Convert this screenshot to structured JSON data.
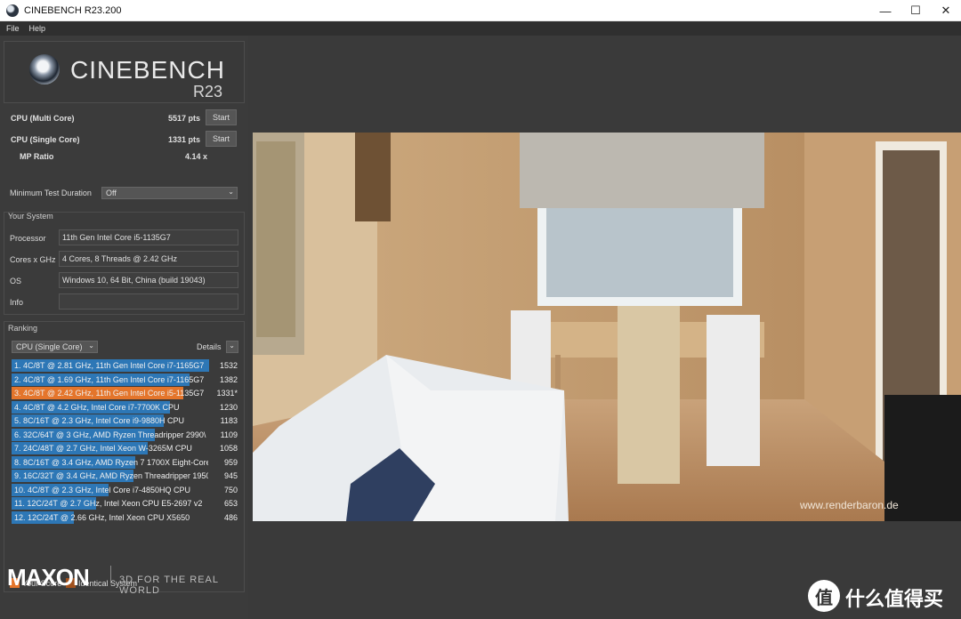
{
  "window": {
    "title": "CINEBENCH R23.200",
    "minimize": "—",
    "maximize": "☐",
    "close": "✕"
  },
  "menu": [
    "File",
    "Help"
  ],
  "logo": {
    "name": "CINEBENCH",
    "version": "R23"
  },
  "scores": {
    "multi": {
      "label": "CPU (Multi Core)",
      "value": "5517 pts",
      "button": "Start"
    },
    "single": {
      "label": "CPU (Single Core)",
      "value": "1331 pts",
      "button": "Start"
    },
    "ratio": {
      "label": "MP Ratio",
      "value": "4.14 x"
    },
    "min_duration": {
      "label": "Minimum Test Duration",
      "value": "Off"
    }
  },
  "system": {
    "title": "Your System",
    "rows": [
      {
        "label": "Processor",
        "value": "11th Gen Intel Core i5-1135G7"
      },
      {
        "label": "Cores x GHz",
        "value": "4 Cores, 8 Threads @ 2.42 GHz"
      },
      {
        "label": "OS",
        "value": "Windows 10, 64 Bit, China (build 19043)"
      },
      {
        "label": "Info",
        "value": ""
      }
    ]
  },
  "ranking": {
    "title": "Ranking",
    "filter": "CPU (Single Core)",
    "details": "Details",
    "max_score": 1532,
    "entries": [
      {
        "label": "1. 4C/8T @ 2.81 GHz, 11th Gen Intel Core i7-1165G7",
        "score": "1532",
        "value": 1532,
        "mine": false
      },
      {
        "label": "2. 4C/8T @ 1.69 GHz, 11th Gen Intel Core i7-1165G7",
        "score": "1382",
        "value": 1382,
        "mine": false
      },
      {
        "label": "3. 4C/8T @ 2.42 GHz, 11th Gen Intel Core i5-1135G7",
        "score": "1331*",
        "value": 1331,
        "mine": true
      },
      {
        "label": "4. 4C/8T @ 4.2 GHz, Intel Core i7-7700K CPU",
        "score": "1230",
        "value": 1230,
        "mine": false
      },
      {
        "label": "5. 8C/16T @ 2.3 GHz, Intel Core i9-9880H CPU",
        "score": "1183",
        "value": 1183,
        "mine": false
      },
      {
        "label": "6. 32C/64T @ 3 GHz, AMD Ryzen Threadripper 2990\\",
        "score": "1109",
        "value": 1109,
        "mine": false
      },
      {
        "label": "7. 24C/48T @ 2.7 GHz, Intel Xeon W-3265M CPU",
        "score": "1058",
        "value": 1058,
        "mine": false
      },
      {
        "label": "8. 8C/16T @ 3.4 GHz, AMD Ryzen 7 1700X Eight-Core",
        "score": "959",
        "value": 959,
        "mine": false
      },
      {
        "label": "9. 16C/32T @ 3.4 GHz, AMD Ryzen Threadripper 1950",
        "score": "945",
        "value": 945,
        "mine": false
      },
      {
        "label": "10. 4C/8T @ 2.3 GHz, Intel Core i7-4850HQ CPU",
        "score": "750",
        "value": 750,
        "mine": false
      },
      {
        "label": "11. 12C/24T @ 2.7 GHz, Intel Xeon CPU E5-2697 v2",
        "score": "653",
        "value": 653,
        "mine": false
      },
      {
        "label": "12. 12C/24T @ 2.66 GHz, Intel Xeon CPU X5650",
        "score": "486",
        "value": 486,
        "mine": false
      }
    ],
    "legend": {
      "your_score": "Your Score",
      "identical": "Identical System"
    }
  },
  "footer": {
    "brand": "MAXON",
    "tagline": "3D FOR THE REAL WORLD"
  },
  "render": {
    "watermark": "www.renderbaron.de"
  },
  "site_watermark": {
    "logo": "值",
    "text": "什么值得买"
  },
  "colors": {
    "bar": "#2d77b6",
    "mine": "#e4752b",
    "identical": "#a0501c"
  }
}
